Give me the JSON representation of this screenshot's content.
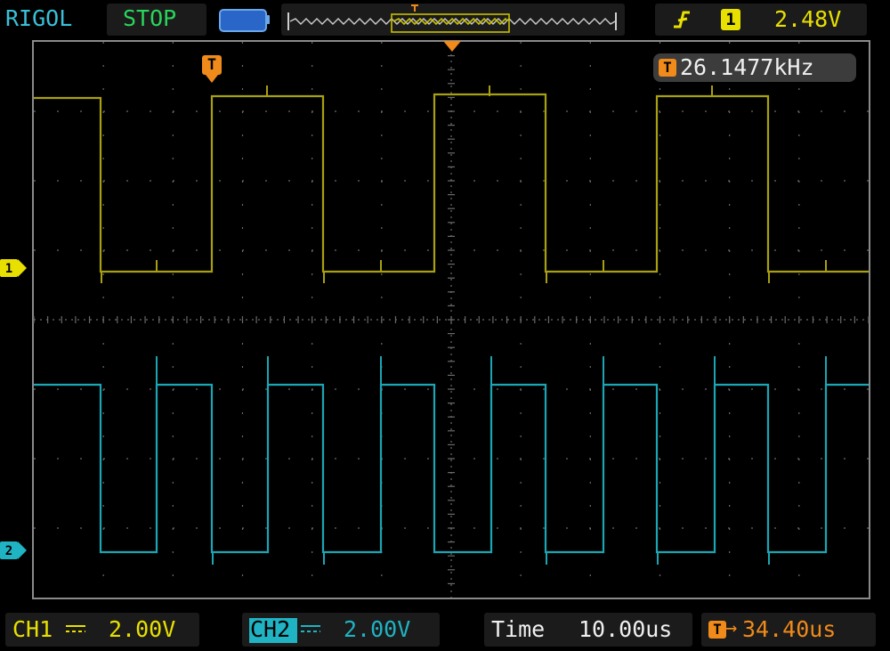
{
  "brand": "RIGOL",
  "run_state": "STOP",
  "trigger": {
    "source_channel": "1",
    "level": "2.48V",
    "edge_icon": "rising-edge-icon"
  },
  "frequency_readout": {
    "marker": "T",
    "value": "26.1477kHz"
  },
  "trigger_marker_label": "T",
  "channel_markers": {
    "ch1": "1",
    "ch2": "2"
  },
  "bottom": {
    "ch1_label": "CH1",
    "ch1_scale": "2.00V",
    "ch2_label": "CH2",
    "ch2_scale": "2.00V",
    "time_label": "Time",
    "time_scale": "10.00us",
    "trigger_offset_marker": "T",
    "trigger_offset_arrow": "→",
    "trigger_offset": "34.40us"
  },
  "colors": {
    "ch1": "#c8c000",
    "ch2": "#1fb3c3",
    "brand": "#39c1d9",
    "stop": "#29d55a",
    "trigger": "#f08a1a",
    "grid": "#6a6a6a",
    "ch1_trace": "#a8a010",
    "ch2_trace": "#1aa6b4"
  },
  "icons": {
    "battery": "battery-icon",
    "waveform_overview": "memory-overview-icon"
  }
}
